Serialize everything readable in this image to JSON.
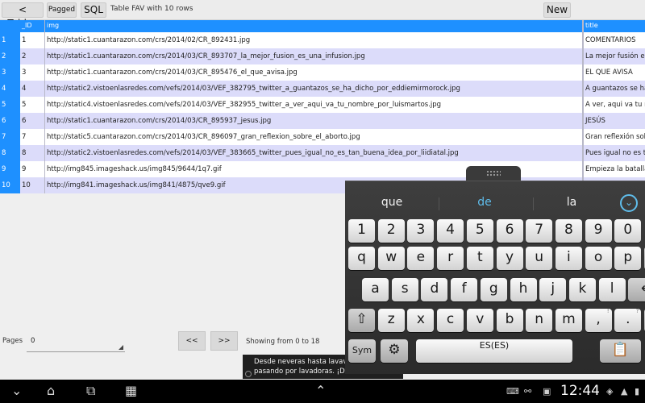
{
  "toolbar": {
    "back_label": "< Tables",
    "pagged_label": "Pagged",
    "sql_label": "SQL",
    "table_info": "Table FAV with 10 rows",
    "new_label": "New"
  },
  "table": {
    "columns": [
      "_ID",
      "img",
      "title"
    ],
    "rows": [
      {
        "n": "1",
        "id": "1",
        "img": "http://static1.cuantarazon.com/crs/2014/02/CR_892431.jpg",
        "title": "COMENTARIOS"
      },
      {
        "n": "2",
        "id": "2",
        "img": "http://static1.cuantarazon.com/crs/2014/03/CR_893707_la_mejor_fusion_es_una_infusion.jpg",
        "title": "La mejor fusión es"
      },
      {
        "n": "3",
        "id": "3",
        "img": "http://static1.cuantarazon.com/crs/2014/03/CR_895476_el_que_avisa.jpg",
        "title": "EL QUE AVISA"
      },
      {
        "n": "4",
        "id": "4",
        "img": "http://static2.vistoenlasredes.com/vefs/2014/03/VEF_382795_twitter_a_guantazos_se_ha_dicho_por_eddiemirmorock.jpg",
        "title": "A guantazos se ha d"
      },
      {
        "n": "5",
        "id": "5",
        "img": "http://static4.vistoenlasredes.com/vefs/2014/03/VEF_382955_twitter_a_ver_aqui_va_tu_nombre_por_luismartos.jpg",
        "title": "A ver, aqui va tu no"
      },
      {
        "n": "6",
        "id": "6",
        "img": "http://static1.cuantarazon.com/crs/2014/03/CR_895937_jesus.jpg",
        "title": "JESÚS"
      },
      {
        "n": "7",
        "id": "7",
        "img": "http://static5.cuantarazon.com/crs/2014/03/CR_896097_gran_reflexion_sobre_el_aborto.jpg",
        "title": "Gran reflexión sobre"
      },
      {
        "n": "8",
        "id": "8",
        "img": "http://static2.vistoenlasredes.com/vefs/2014/03/VEF_383665_twitter_pues_igual_no_es_tan_buena_idea_por_liidiatal.jpg",
        "title": "Pues igual no es tan"
      },
      {
        "n": "9",
        "id": "9",
        "img": "http://img845.imageshack.us/img845/9644/1q7.gif",
        "title": "Empieza la batalla"
      },
      {
        "n": "10",
        "id": "10",
        "img": "http://img841.imageshack.us/img841/4875/qve9.gif",
        "title": ""
      }
    ]
  },
  "paging": {
    "pages_label": "Pages",
    "pages_value": "0",
    "prev_label": "<<",
    "next_label": ">>",
    "showing_text": "Showing from 0 to 18"
  },
  "toast": {
    "line1": "Desde neveras hasta lavavaji",
    "line2": "pasando por lavadoras. ¡De t"
  },
  "keyboard": {
    "suggestions": [
      "que",
      "de",
      "la"
    ],
    "row1": [
      "1",
      "2",
      "3",
      "4",
      "5",
      "6",
      "7",
      "8",
      "9",
      "0"
    ],
    "row2": [
      "q",
      "w",
      "e",
      "r",
      "t",
      "y",
      "u",
      "i",
      "o",
      "p"
    ],
    "row3": [
      "a",
      "s",
      "d",
      "f",
      "g",
      "h",
      "j",
      "k",
      "l"
    ],
    "row4": [
      "z",
      "x",
      "c",
      "v",
      "b",
      "n",
      "m"
    ],
    "row4_punct": [
      ",",
      "."
    ],
    "row4_punct_sub": [
      "!",
      "?"
    ],
    "sym_label": "Sym",
    "space_label": "ES(ES)",
    "accent_color": "#5fbcea"
  },
  "status": {
    "clock": "12:44"
  },
  "colors": {
    "header_blue": "#1e90ff",
    "row_alt": "#dcdcfa"
  }
}
